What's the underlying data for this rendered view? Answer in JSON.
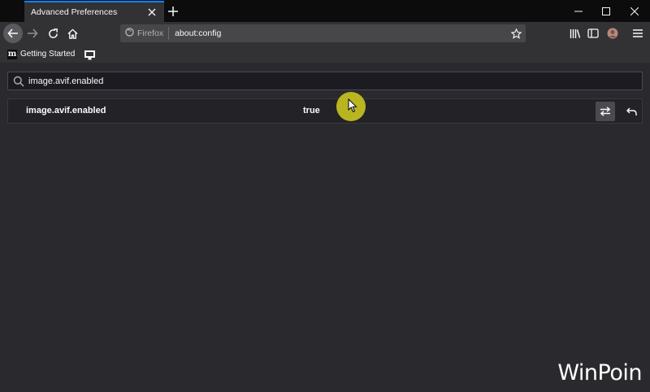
{
  "tab": {
    "title": "Advanced Preferences"
  },
  "navbar": {
    "identity_label": "Firefox",
    "url": "about:config"
  },
  "bookmarks": [
    {
      "label": "Getting Started",
      "icon": "mdn-m-icon"
    },
    {
      "label": "",
      "icon": "monitor-icon"
    }
  ],
  "search": {
    "value": "image.avif.enabled"
  },
  "preference": {
    "name": "image.avif.enabled",
    "value": "true"
  },
  "colors": {
    "accent": "#0a84ff",
    "toolbar": "#323234",
    "content_bg": "#2a2a2e",
    "cursor_highlight": "#c9c520"
  },
  "watermark": "WinPoin"
}
